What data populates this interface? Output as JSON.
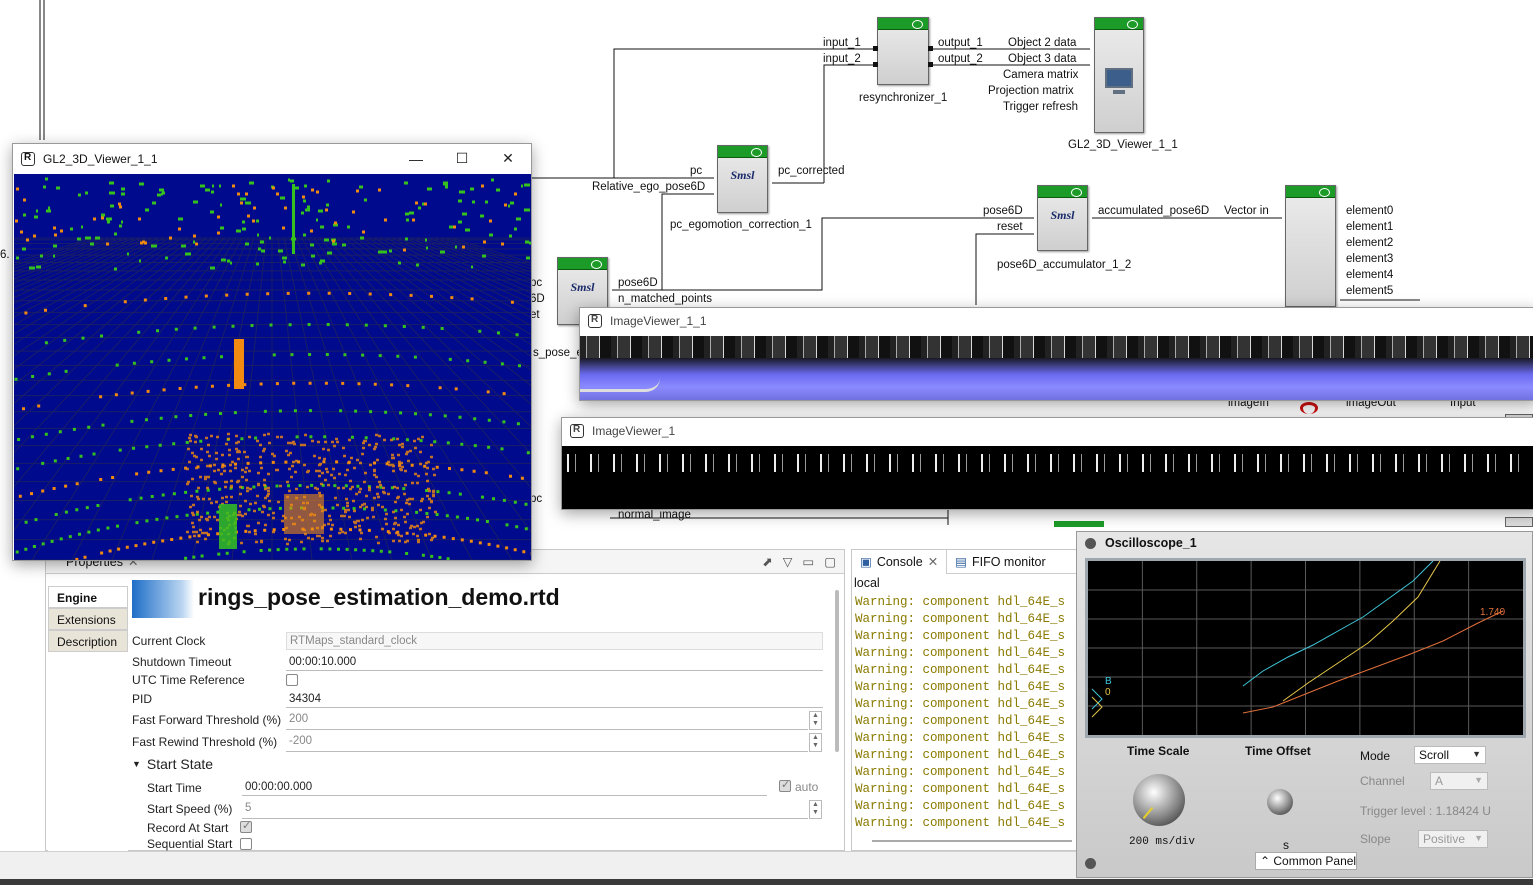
{
  "diagram": {
    "components": {
      "resynchronizer": {
        "name": "resynchronizer_1",
        "inputs": [
          "input_1",
          "input_2"
        ],
        "outputs": [
          "output_1",
          "output_2"
        ]
      },
      "gl2_viewer": {
        "name": "GL2_3D_Viewer_1_1",
        "inputs": [
          "Object 2 data",
          "Object 3 data",
          "Camera matrix",
          "Projection matrix",
          "Trigger refresh"
        ]
      },
      "pc_egomotion": {
        "name": "pc_egomotion_correction_1",
        "inputs": [
          "pc",
          "Relative_ego_pose6D"
        ],
        "outputs": [
          "pc_corrected"
        ],
        "icon": "Smsl"
      },
      "pose_accumulator": {
        "name": "pose6D_accumulator_1_2",
        "inputs": [
          "pose6D",
          "reset"
        ],
        "outputs": [
          "accumulated_pose6D"
        ],
        "icon": "Smsl"
      },
      "vector": {
        "inputs": [
          "Vector in"
        ],
        "outputs": [
          "element0",
          "element1",
          "element2",
          "element3",
          "element4",
          "element5"
        ]
      },
      "pose_estimation": {
        "name_fragment": "s_pose_es",
        "inputs_fragments": [
          "pc",
          "6D",
          "et"
        ],
        "outputs": [
          "pose6D",
          "n_matched_points"
        ],
        "icon": "Smsl"
      },
      "misc_labels": {
        "left_number": "6.",
        "imagein": "imageIn",
        "imageout": "imageOut",
        "input": "Input",
        "pc_lower": "pc",
        "normal_image": "normal_image"
      }
    }
  },
  "viewer3d": {
    "title": "GL2_3D_Viewer_1_1",
    "min_glyph": "—",
    "max_glyph": "☐",
    "close_glyph": "✕",
    "colors": {
      "background": "#000a8c",
      "grid": "#1a1f66",
      "points_green": "#35c21e",
      "points_orange": "#f08a10"
    }
  },
  "imageviewer_top": {
    "title": "ImageViewer_1_1"
  },
  "imageviewer_bottom": {
    "title": "ImageViewer_1"
  },
  "properties": {
    "tab_label": "Properties",
    "side_tabs": [
      "Engine",
      "Extensions",
      "Description"
    ],
    "title": "rings_pose_estimation_demo.rtd",
    "fields": {
      "current_clock": {
        "label": "Current Clock",
        "value": "RTMaps_standard_clock"
      },
      "shutdown_timeout": {
        "label": "Shutdown Timeout",
        "value": "00:00:10.000"
      },
      "utc_reference": {
        "label": "UTC Time Reference"
      },
      "pid": {
        "label": "PID",
        "value": "34304"
      },
      "ff_threshold": {
        "label": "Fast Forward Threshold (%)",
        "value": "200"
      },
      "fr_threshold": {
        "label": "Fast Rewind Threshold (%)",
        "value": "-200"
      }
    },
    "start_state": {
      "header": "Start State",
      "start_time": {
        "label": "Start Time",
        "value": "00:00:00.000",
        "auto_label": "auto"
      },
      "start_speed": {
        "label": "Start Speed (%)",
        "value": "5"
      },
      "record_at_start": {
        "label": "Record At Start"
      },
      "sequential_start": {
        "label": "Sequential Start"
      }
    }
  },
  "console": {
    "tab_console": "Console",
    "tab_fifo": "FIFO monitor",
    "scope": "local",
    "lines": [
      "Warning: component hdl_64E_s",
      "Warning: component hdl_64E_s",
      "Warning: component hdl_64E_s",
      "Warning: component hdl_64E_s",
      "Warning: component hdl_64E_s",
      "Warning: component hdl_64E_s",
      "Warning: component hdl_64E_s",
      "Warning: component hdl_64E_s",
      "Warning: component hdl_64E_s",
      "Warning: component hdl_64E_s",
      "Warning: component hdl_64E_s",
      "Warning: component hdl_64E_s",
      "Warning: component hdl_64E_s",
      "Warning: component hdl_64E_s"
    ]
  },
  "oscilloscope": {
    "title": "Oscilloscope_1",
    "trace_value": "1.740",
    "channel_marks": [
      "B",
      "0"
    ],
    "time_scale_label": "Time Scale",
    "time_scale_value": "200 ms/div",
    "time_offset_label": "Time Offset",
    "time_offset_unit": "s",
    "mode_label": "Mode",
    "mode_value": "Scroll",
    "channel_label": "Channel",
    "channel_value": "A",
    "trigger_label": "Trigger level : 1.18424 U",
    "slope_label": "Slope",
    "slope_value": "Positive",
    "common_panel": "Common Panel",
    "colors": {
      "screen": "#000000",
      "grid": "#5a5a5a",
      "trace_cyan": "#3fc7d8",
      "trace_yellow": "#e6c84a",
      "trace_orange": "#e2703a"
    }
  }
}
